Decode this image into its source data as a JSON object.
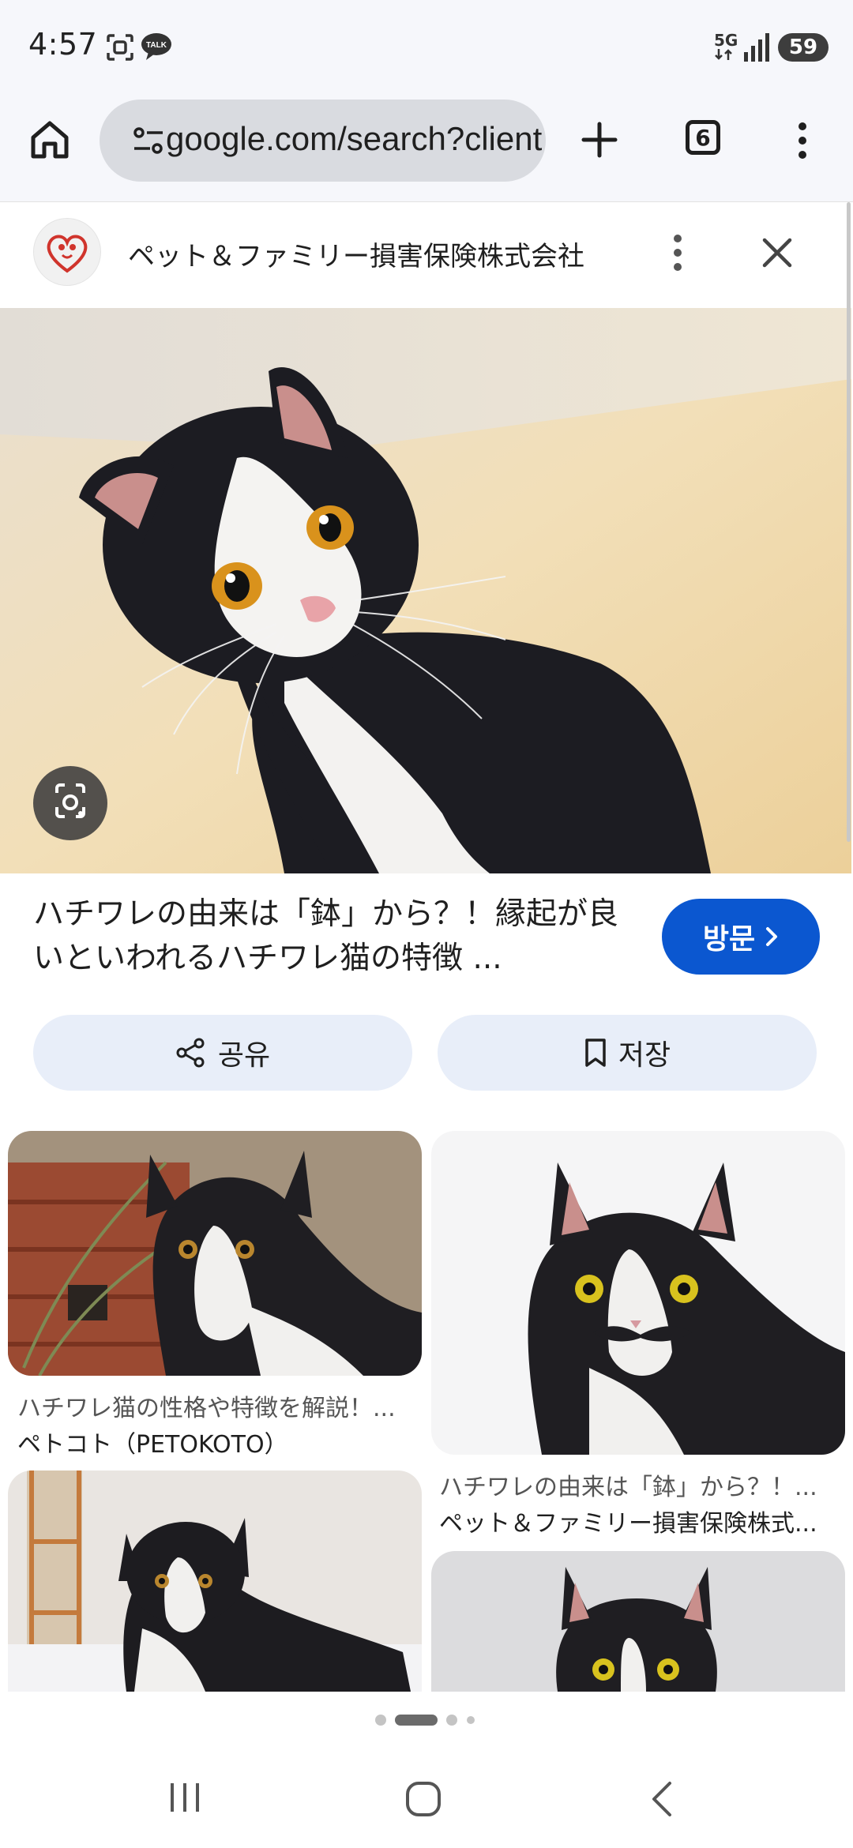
{
  "status_bar": {
    "time": "4:57",
    "network": "5G",
    "battery": "59",
    "icons": [
      "screenshot-icon",
      "talk-icon",
      "signal-icon"
    ]
  },
  "browser": {
    "url": "google.com/search?client",
    "tab_count": "6",
    "icons": [
      "home-icon",
      "site-info-icon",
      "new-tab-icon",
      "more-icon"
    ]
  },
  "source": {
    "name": "ペット＆ファミリー損害保険株式会社"
  },
  "result": {
    "title": "ハチワレの由来は「鉢」から？！縁起が良いといわれるハチワレ猫の特徴 ...",
    "visit_label": "방문",
    "share_label": "공유",
    "save_label": "저장"
  },
  "related": [
    {
      "caption": "ハチワレ猫の性格や特徴を解説！...",
      "source": "ペトコト（PETOKOTO）"
    },
    {
      "caption": "ハチワレの由来は「鉢」から？！...",
      "source": "ペット＆ファミリー損害保険株式..."
    }
  ],
  "colors": {
    "accent": "#0b57d0",
    "chip_bg": "#e8eef9",
    "toolbar_bg": "#f6f7fb"
  }
}
